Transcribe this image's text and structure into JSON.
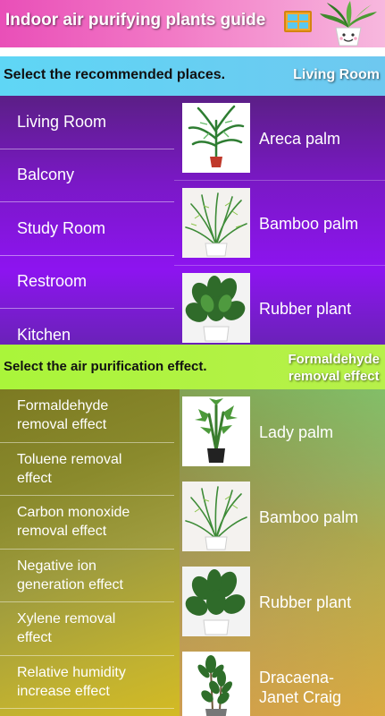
{
  "header": {
    "title": "Indoor air purifying plants guide",
    "window_icon": "window-icon",
    "logo": "potted-plant-logo"
  },
  "section1": {
    "prompt": "Select the recommended places.",
    "selected": "Living Room",
    "places": [
      "Living Room",
      "Balcony",
      "Study Room",
      "Restroom",
      "Kitchen"
    ],
    "plants": [
      "Areca palm",
      "Bamboo palm",
      "Rubber plant"
    ]
  },
  "section2": {
    "prompt": "Select the air purification effect.",
    "selected_line1": "Formaldehyde",
    "selected_line2": "removal effect",
    "effects": [
      [
        "Formaldehyde",
        "removal effect"
      ],
      [
        "Toluene removal",
        "effect"
      ],
      [
        "Carbon monoxide",
        "removal effect"
      ],
      [
        "Negative ion",
        "generation effect"
      ],
      [
        "Xylene removal",
        "effect"
      ],
      [
        "Relative humidity",
        "increase effect"
      ]
    ],
    "plants": [
      [
        "Lady palm",
        ""
      ],
      [
        "Bamboo palm",
        ""
      ],
      [
        "Rubber plant",
        ""
      ],
      [
        "Dracaena-",
        "Janet Craig"
      ]
    ]
  }
}
